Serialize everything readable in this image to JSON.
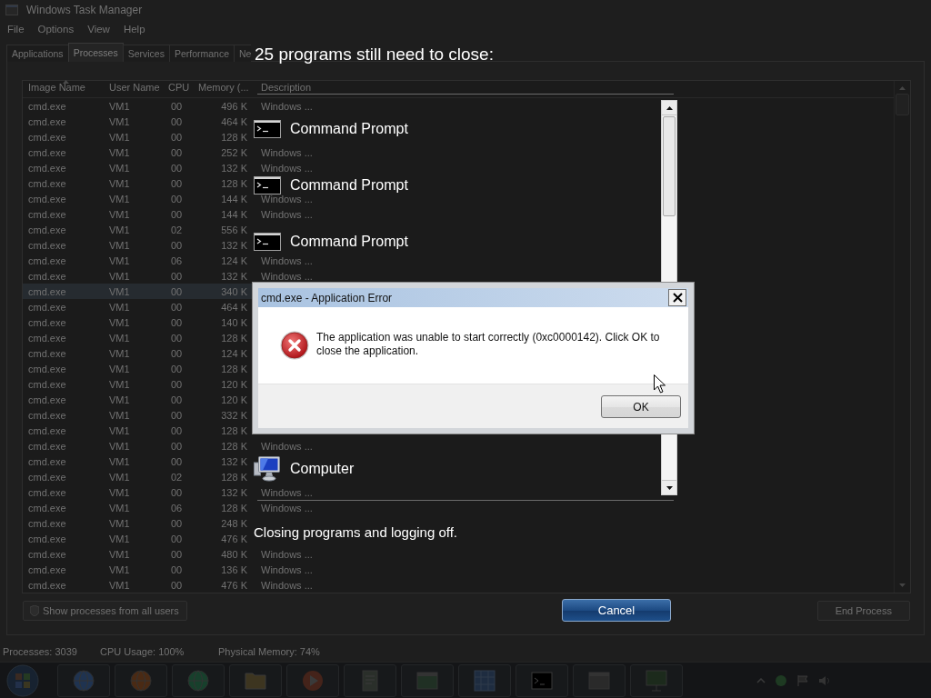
{
  "task_manager": {
    "title": "Windows Task Manager",
    "menu": [
      "File",
      "Options",
      "View",
      "Help"
    ],
    "tabs": [
      {
        "label": "Applications",
        "selected": false
      },
      {
        "label": "Processes",
        "selected": true
      },
      {
        "label": "Services",
        "selected": false
      },
      {
        "label": "Performance",
        "selected": false
      },
      {
        "label": "Ne",
        "selected": false
      }
    ],
    "columns": [
      "Image Name",
      "User Name",
      "CPU",
      "Memory (...",
      "Description"
    ],
    "rows": [
      {
        "image_name": "cmd.exe",
        "user_name": "VM1",
        "cpu": "00",
        "memory": "496 K",
        "description": "Windows ...",
        "selected": false
      },
      {
        "image_name": "cmd.exe",
        "user_name": "VM1",
        "cpu": "00",
        "memory": "464 K",
        "selected": false
      },
      {
        "image_name": "cmd.exe",
        "user_name": "VM1",
        "cpu": "00",
        "memory": "128 K",
        "selected": false
      },
      {
        "image_name": "cmd.exe",
        "user_name": "VM1",
        "cpu": "00",
        "memory": "252 K",
        "description": "Windows ...",
        "selected": false
      },
      {
        "image_name": "cmd.exe",
        "user_name": "VM1",
        "cpu": "00",
        "memory": "132 K",
        "description": "Windows ...",
        "selected": false
      },
      {
        "image_name": "cmd.exe",
        "user_name": "VM1",
        "cpu": "00",
        "memory": "128 K",
        "selected": false
      },
      {
        "image_name": "cmd.exe",
        "user_name": "VM1",
        "cpu": "00",
        "memory": "144 K",
        "description": "Windows ...",
        "selected": false
      },
      {
        "image_name": "cmd.exe",
        "user_name": "VM1",
        "cpu": "00",
        "memory": "144 K",
        "description": "Windows ...",
        "selected": false
      },
      {
        "image_name": "cmd.exe",
        "user_name": "VM1",
        "cpu": "02",
        "memory": "556 K",
        "selected": false
      },
      {
        "image_name": "cmd.exe",
        "user_name": "VM1",
        "cpu": "00",
        "memory": "132 K",
        "selected": false
      },
      {
        "image_name": "cmd.exe",
        "user_name": "VM1",
        "cpu": "06",
        "memory": "124 K",
        "description": "Windows ...",
        "selected": false
      },
      {
        "image_name": "cmd.exe",
        "user_name": "VM1",
        "cpu": "00",
        "memory": "132 K",
        "description": "Windows ...",
        "selected": false
      },
      {
        "image_name": "cmd.exe",
        "user_name": "VM1",
        "cpu": "00",
        "memory": "340 K",
        "selected": true
      },
      {
        "image_name": "cmd.exe",
        "user_name": "VM1",
        "cpu": "00",
        "memory": "464 K",
        "selected": false
      },
      {
        "image_name": "cmd.exe",
        "user_name": "VM1",
        "cpu": "00",
        "memory": "140 K",
        "selected": false
      },
      {
        "image_name": "cmd.exe",
        "user_name": "VM1",
        "cpu": "00",
        "memory": "128 K",
        "selected": false
      },
      {
        "image_name": "cmd.exe",
        "user_name": "VM1",
        "cpu": "00",
        "memory": "124 K",
        "selected": false
      },
      {
        "image_name": "cmd.exe",
        "user_name": "VM1",
        "cpu": "00",
        "memory": "128 K",
        "selected": false
      },
      {
        "image_name": "cmd.exe",
        "user_name": "VM1",
        "cpu": "00",
        "memory": "120 K",
        "selected": false
      },
      {
        "image_name": "cmd.exe",
        "user_name": "VM1",
        "cpu": "00",
        "memory": "120 K",
        "selected": false
      },
      {
        "image_name": "cmd.exe",
        "user_name": "VM1",
        "cpu": "00",
        "memory": "332 K",
        "selected": false
      },
      {
        "image_name": "cmd.exe",
        "user_name": "VM1",
        "cpu": "00",
        "memory": "128 K",
        "selected": false
      },
      {
        "image_name": "cmd.exe",
        "user_name": "VM1",
        "cpu": "00",
        "memory": "128 K",
        "description": "Windows ...",
        "selected": false
      },
      {
        "image_name": "cmd.exe",
        "user_name": "VM1",
        "cpu": "00",
        "memory": "132 K",
        "selected": false
      },
      {
        "image_name": "cmd.exe",
        "user_name": "VM1",
        "cpu": "02",
        "memory": "128 K",
        "selected": false
      },
      {
        "image_name": "cmd.exe",
        "user_name": "VM1",
        "cpu": "00",
        "memory": "132 K",
        "description": "Windows ...",
        "selected": false
      },
      {
        "image_name": "cmd.exe",
        "user_name": "VM1",
        "cpu": "06",
        "memory": "128 K",
        "description": "Windows ...",
        "selected": false
      },
      {
        "image_name": "cmd.exe",
        "user_name": "VM1",
        "cpu": "00",
        "memory": "248 K",
        "selected": false
      },
      {
        "image_name": "cmd.exe",
        "user_name": "VM1",
        "cpu": "00",
        "memory": "476 K",
        "selected": false
      },
      {
        "image_name": "cmd.exe",
        "user_name": "VM1",
        "cpu": "00",
        "memory": "480 K",
        "description": "Windows ...",
        "selected": false
      },
      {
        "image_name": "cmd.exe",
        "user_name": "VM1",
        "cpu": "00",
        "memory": "136 K",
        "description": "Windows ...",
        "selected": false
      },
      {
        "image_name": "cmd.exe",
        "user_name": "VM1",
        "cpu": "00",
        "memory": "476 K",
        "description": "Windows ...",
        "selected": false
      }
    ],
    "show_all_button": "Show processes from all users",
    "end_button": "End Process",
    "status_bar": [
      "Processes: 3039",
      "CPU Usage: 100%",
      "Physical Memory: 74%"
    ]
  },
  "logoff": {
    "heading": "25 programs still need to close:",
    "programs": [
      {
        "name": "Command Prompt",
        "kind": "console"
      },
      {
        "name": "Command Prompt",
        "kind": "console"
      },
      {
        "name": "Command Prompt",
        "kind": "console"
      },
      {
        "name": "Computer",
        "kind": "computer"
      }
    ],
    "status": "Closing programs and logging off.",
    "cancel": "Cancel"
  },
  "error_dialog": {
    "title": "cmd.exe - Application Error",
    "message": "The application was unable to start correctly (0xc0000142). Click OK to close the application.",
    "ok": "OK"
  }
}
